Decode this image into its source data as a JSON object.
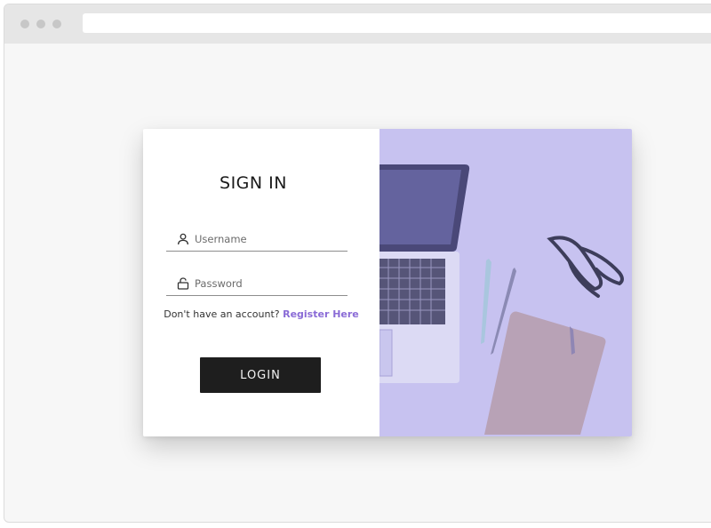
{
  "browser": {
    "url": ""
  },
  "signin": {
    "title": "SIGN IN",
    "username": {
      "placeholder": "Username",
      "value": "",
      "icon": "user-icon"
    },
    "password": {
      "placeholder": "Password",
      "value": "",
      "icon": "lock-icon"
    },
    "register_prompt": "Don't have an account?",
    "register_link": "Register Here",
    "login_label": "LOGIN"
  },
  "colors": {
    "accent": "#8a6bd6",
    "button": "#1e1e1e",
    "image_tint": "#c7c2f0"
  }
}
